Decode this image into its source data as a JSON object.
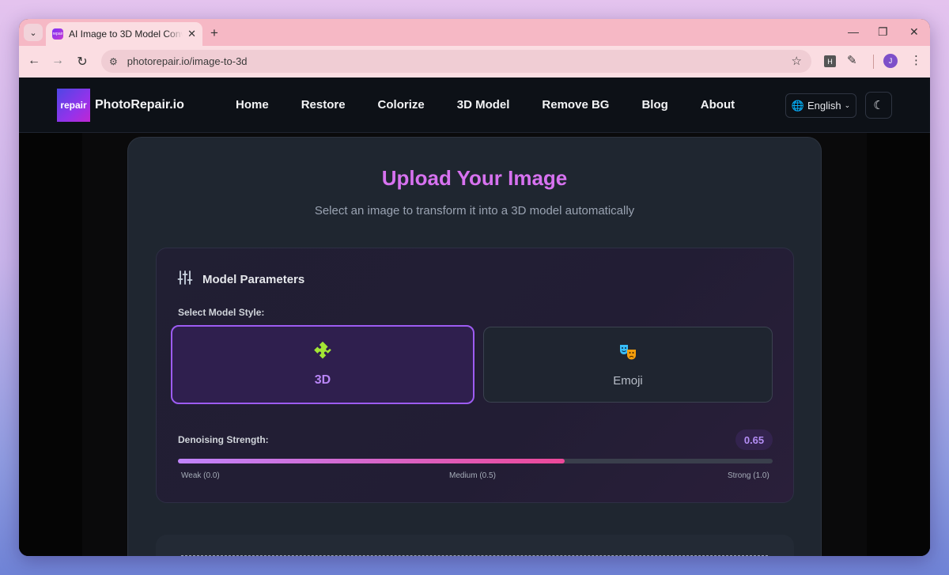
{
  "browser": {
    "tab_title": "AI Image to 3D Model Converter",
    "tab_favicon_text": "repair",
    "url": "photorepair.io/image-to-3d",
    "extension_badge": "H",
    "profile_initial": "J"
  },
  "header": {
    "logo_text": "repair",
    "site_name": "PhotoRepair.io",
    "nav": [
      "Home",
      "Restore",
      "Colorize",
      "3D Model",
      "Remove BG",
      "Blog",
      "About"
    ],
    "language": "English"
  },
  "upload": {
    "title": "Upload Your Image",
    "subtitle": "Select an image to transform it into a 3D model automatically"
  },
  "params": {
    "title": "Model Parameters",
    "style_label": "Select Model Style:",
    "styles": [
      {
        "label": "3D",
        "icon": "puzzle-icon",
        "selected": true
      },
      {
        "label": "Emoji",
        "icon": "theater-masks-icon",
        "selected": false
      }
    ],
    "denoise_label": "Denoising Strength:",
    "denoise_value": "0.65",
    "denoise_fraction": 0.65,
    "marks": {
      "weak": "Weak (0.0)",
      "medium": "Medium (0.5)",
      "strong": "Strong (1.0)"
    }
  },
  "colors": {
    "accent": "#d772f0",
    "selected_border": "#9d5cf2",
    "slider_start": "#c084fc",
    "slider_end": "#ec4899"
  }
}
